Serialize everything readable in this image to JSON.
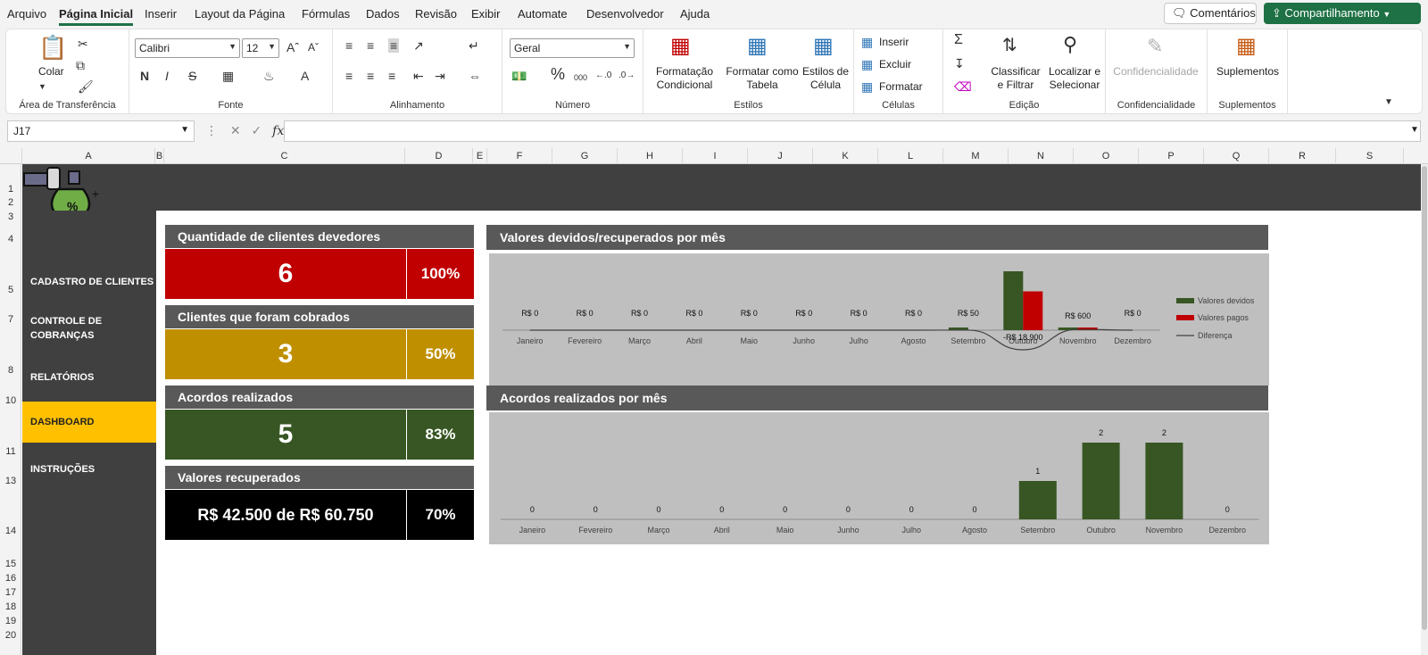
{
  "menu": {
    "tabs": [
      "Arquivo",
      "Página Inicial",
      "Inserir",
      "Layout da Página",
      "Fórmulas",
      "Dados",
      "Revisão",
      "Exibir",
      "Automate",
      "Desenvolvedor",
      "Ajuda"
    ],
    "comments_label": "Comentários",
    "share_label": "Compartilhamento"
  },
  "ribbon": {
    "clipboard": {
      "paste": "Colar",
      "label": "Área de Transferência"
    },
    "font": {
      "name": "Calibri",
      "size": "12",
      "label": "Fonte",
      "bold": "N",
      "italic": "I",
      "strike": "S"
    },
    "alignment": {
      "label": "Alinhamento"
    },
    "number": {
      "format": "Geral",
      "label": "Número",
      "percent": "%",
      "thousands": "000"
    },
    "styles": {
      "conditional": [
        "Formatação",
        "Condicional"
      ],
      "table": [
        "Formatar como",
        "Tabela"
      ],
      "cell": [
        "Estilos de",
        "Célula"
      ],
      "label": "Estilos"
    },
    "cells": {
      "insert": "Inserir",
      "delete": "Excluir",
      "format": "Formatar",
      "label": "Células"
    },
    "editing": {
      "sort": [
        "Classificar",
        "e Filtrar"
      ],
      "find": [
        "Localizar e",
        "Selecionar"
      ],
      "label": "Edição"
    },
    "confidentiality": {
      "button": "Confidencialidade",
      "label": "Confidencialidade"
    },
    "addins": {
      "button": "Suplementos",
      "label": "Suplementos"
    }
  },
  "formula_bar": {
    "name_box": "J17",
    "fx": "fx",
    "formula": ""
  },
  "columns": [
    "A",
    "B",
    "C",
    "D",
    "E",
    "F",
    "G",
    "H",
    "I",
    "J",
    "K",
    "L",
    "M",
    "N",
    "O",
    "P",
    "Q",
    "R",
    "S"
  ],
  "rows": [
    "1",
    "2",
    "3",
    "4",
    "5",
    "7",
    "8",
    "10",
    "11",
    "13",
    "14",
    "15",
    "16",
    "17",
    "18",
    "19",
    "20"
  ],
  "sidebar": {
    "items": [
      {
        "label": "CADASTRO DE CLIENTES",
        "active": false
      },
      {
        "label": "CONTROLE DE COBRANÇAS",
        "active": false
      },
      {
        "label": "RELATÓRIOS",
        "active": false
      },
      {
        "label": "DASHBOARD",
        "active": true
      },
      {
        "label": "INSTRUÇÕES",
        "active": false
      }
    ]
  },
  "kpis": [
    {
      "title": "Quantidade de clientes devedores",
      "value": "6",
      "percent": "100%",
      "color": "#c00000",
      "pct_color": "#c00000"
    },
    {
      "title": "Clientes que foram cobrados",
      "value": "3",
      "percent": "50%",
      "color": "#bf8f00",
      "pct_color": "#bf8f00"
    },
    {
      "title": "Acordos realizados",
      "value": "5",
      "percent": "83%",
      "color": "#375623",
      "pct_color": "#375623"
    },
    {
      "title": "Valores recuperados",
      "value": "R$ 42.500 de R$ 60.750",
      "percent": "70%",
      "color": "#000000",
      "pct_color": "#000000"
    }
  ],
  "chart_data": [
    {
      "type": "bar",
      "title": "Valores devidos/recuperados por mês",
      "categories": [
        "Janeiro",
        "Fevereiro",
        "Março",
        "Abril",
        "Maio",
        "Junho",
        "Julho",
        "Agosto",
        "Setembro",
        "Outubro",
        "Novembro",
        "Dezembro"
      ],
      "series": [
        {
          "name": "Valores devidos",
          "values": [
            0,
            0,
            0,
            0,
            0,
            0,
            0,
            0,
            50,
            42500,
            1300,
            0
          ],
          "color": "#375623"
        },
        {
          "name": "Valores pagos",
          "values": [
            0,
            0,
            0,
            0,
            0,
            0,
            0,
            0,
            0,
            28000,
            700,
            0
          ],
          "color": "#c00000"
        },
        {
          "name": "Diferença",
          "type": "line",
          "values": [
            0,
            0,
            0,
            0,
            0,
            0,
            0,
            0,
            50,
            -18900,
            600,
            0
          ],
          "color": "#404040"
        }
      ],
      "data_labels": [
        "R$ 0",
        "R$ 0",
        "R$ 0",
        "R$ 0",
        "R$ 0",
        "R$ 0",
        "R$ 0",
        "R$ 0",
        "R$ 50",
        "-R$ 18.900",
        "R$ 600",
        "R$ 0"
      ],
      "legend": "right",
      "grid": false
    },
    {
      "type": "bar",
      "title": "Acordos realizados por mês",
      "categories": [
        "Janeiro",
        "Fevereiro",
        "Março",
        "Abril",
        "Maio",
        "Junho",
        "Julho",
        "Agosto",
        "Setembro",
        "Outubro",
        "Novembro",
        "Dezembro"
      ],
      "series": [
        {
          "values": [
            0,
            0,
            0,
            0,
            0,
            0,
            0,
            0,
            1,
            2,
            2,
            0
          ],
          "color": "#375623"
        }
      ],
      "ylim": [
        0,
        2
      ],
      "legend": "none",
      "grid": false
    }
  ]
}
